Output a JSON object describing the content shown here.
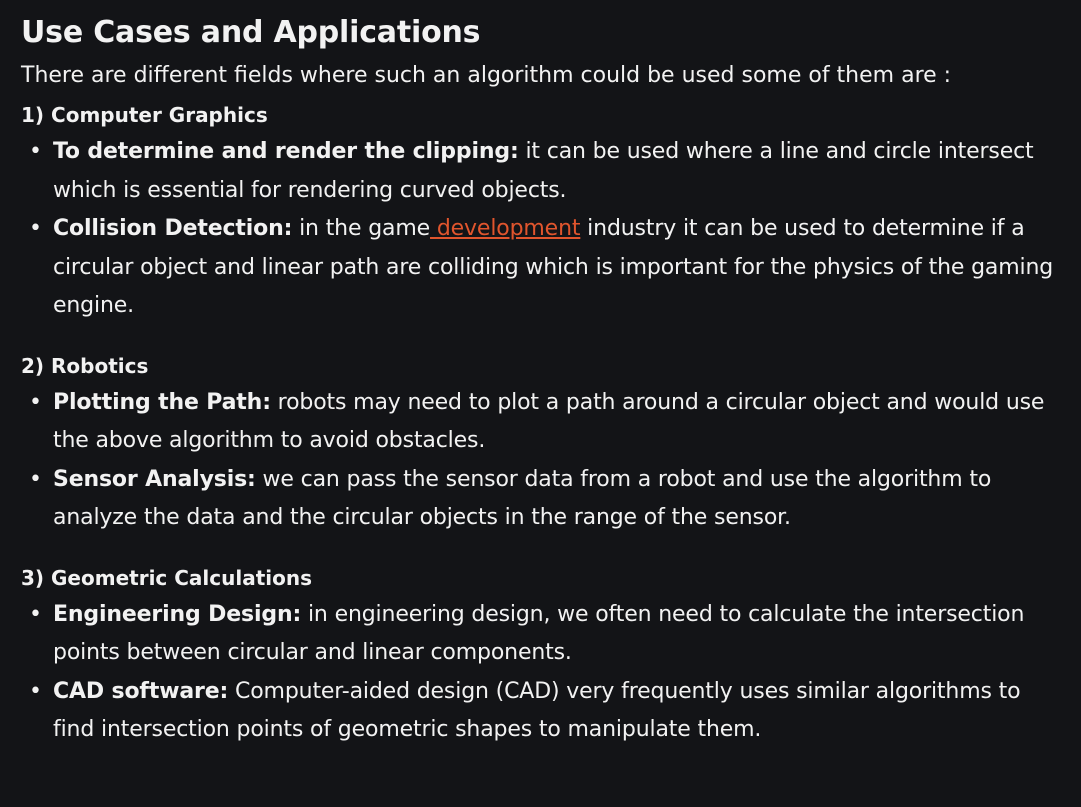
{
  "title": "Use Cases and Applications",
  "intro": "There are different fields where such an algorithm could be used some of them are :",
  "sections": [
    {
      "heading": "1) Computer Graphics",
      "items": [
        {
          "bold": "To determine and render the clipping:",
          "text": " it can be used where a line and circle intersect which is essential for rendering curved objects."
        },
        {
          "bold": "Collision Detection:",
          "text_before": " in the game",
          "link": " development",
          "text_after": " industry it can be used to determine if a circular object and linear path are colliding which is important for the physics of the gaming engine."
        }
      ]
    },
    {
      "heading": "2) Robotics",
      "items": [
        {
          "bold": "Plotting the Path:",
          "text": " robots may need to plot a path around a circular object and would use the above algorithm to avoid obstacles."
        },
        {
          "bold": "Sensor Analysis:",
          "text": " we can pass the sensor data from a robot and use the algorithm to analyze the data and the circular objects in the range of the sensor."
        }
      ]
    },
    {
      "heading": "3) Geometric Calculations",
      "items": [
        {
          "bold": "Engineering Design:",
          "text": " in engineering design, we often need to calculate the intersection points between circular and linear components."
        },
        {
          "bold": "CAD software:",
          "text": " Computer-aided design (CAD) very frequently uses similar algorithms to find intersection points of geometric shapes to manipulate them."
        }
      ]
    }
  ],
  "bullet_glyph": "•",
  "colors": {
    "background": "#131417",
    "text": "#f2f2f2",
    "link": "#e0552d"
  }
}
